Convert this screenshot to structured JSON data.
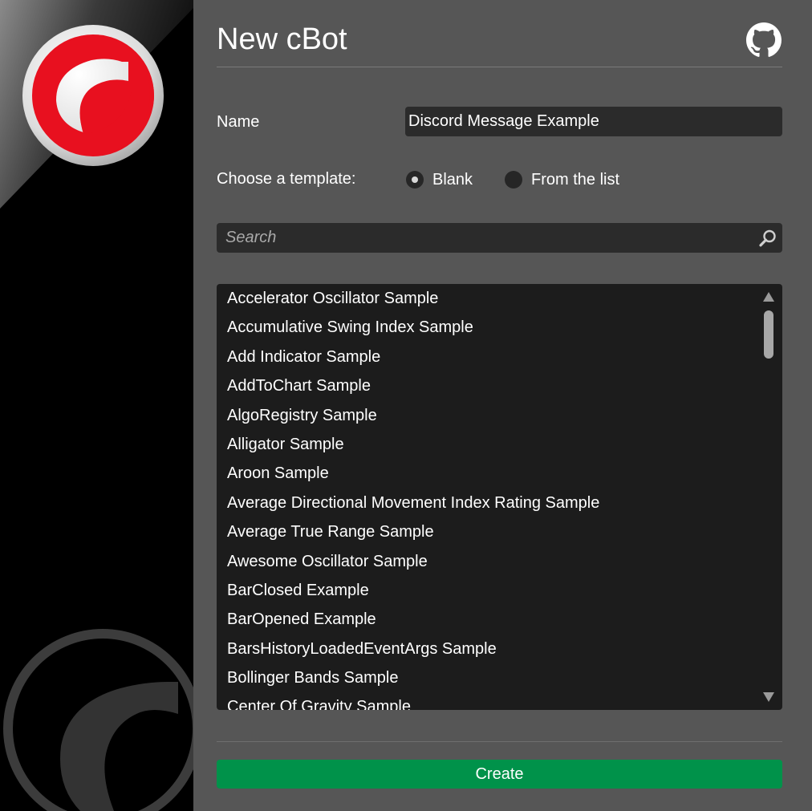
{
  "window": {
    "title": "New cBot"
  },
  "brand": {
    "logo_icon": "ctrader-logo-icon",
    "watermark_icon": "ctrader-watermark-icon",
    "accent_color": "#e8101f"
  },
  "header": {
    "github_icon": "github-icon"
  },
  "form": {
    "name_label": "Name",
    "name_value": "Discord Message Example",
    "template_label": "Choose a template:",
    "template_options": [
      {
        "label": "Blank",
        "checked": true
      },
      {
        "label": "From the list",
        "checked": false
      }
    ]
  },
  "search": {
    "placeholder": "Search",
    "icon": "search-icon"
  },
  "templates": {
    "items": [
      "Accelerator Oscillator Sample",
      "Accumulative Swing Index Sample",
      "Add Indicator Sample",
      "AddToChart Sample",
      "AlgoRegistry Sample",
      "Alligator Sample",
      "Aroon Sample",
      "Average Directional Movement Index Rating Sample",
      "Average True Range Sample",
      "Awesome Oscillator Sample",
      "BarClosed Example",
      "BarOpened Example",
      "BarsHistoryLoadedEventArgs Sample",
      "Bollinger Bands Sample",
      "Center Of Gravity Sample"
    ]
  },
  "actions": {
    "create_label": "Create",
    "create_color": "#00924a"
  }
}
